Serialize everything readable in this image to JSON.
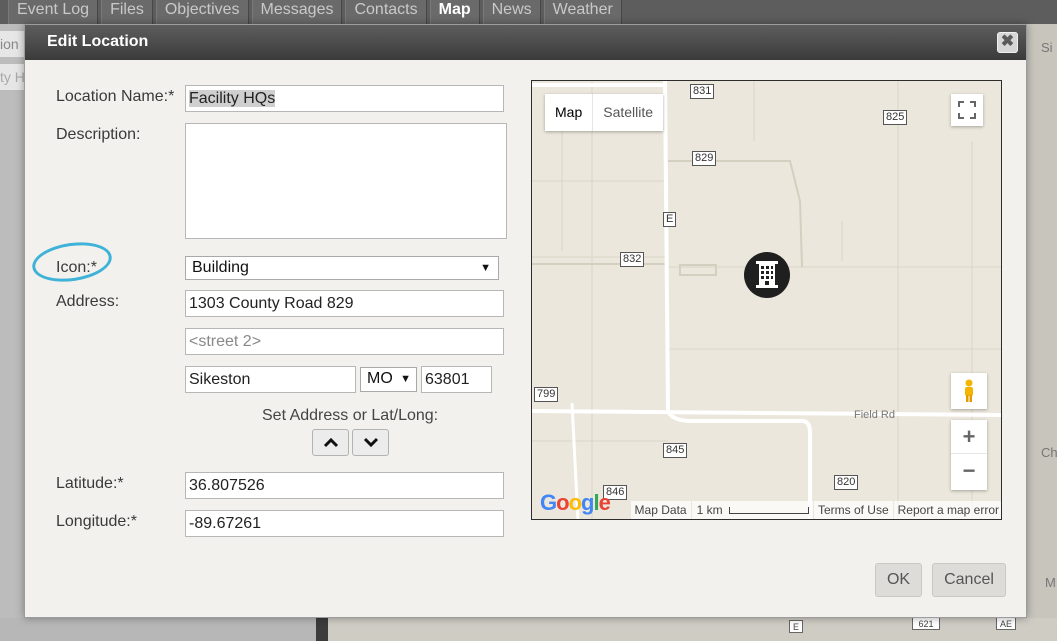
{
  "bg": {
    "tabs": [
      "Event Log",
      "Files",
      "Objectives",
      "Messages",
      "Contacts",
      "Map",
      "News",
      "Weather"
    ],
    "active_tab": "Map",
    "left_frag_1": "ion",
    "left_frag_2": "ty H",
    "right_frag_1": "Si",
    "right_frag_2": "Ch",
    "right_frag_3": "M",
    "shield_621": "621",
    "shield_ae": "AE",
    "shield_e": "E"
  },
  "dialog": {
    "title": "Edit Location",
    "close_glyph": "✖",
    "labels": {
      "location_name": "Location Name:*",
      "description": "Description:",
      "icon": "Icon:*",
      "address": "Address:",
      "latitude": "Latitude:*",
      "longitude": "Longitude:*"
    },
    "location_name": "Facility HQs",
    "description": "",
    "icon_value": "Building",
    "address_1": "1303 County Road 829",
    "address_2_placeholder": "<street 2>",
    "city": "Sikeston",
    "state": "MO",
    "zip": "63801",
    "set_address_label": "Set Address or Lat/Long:",
    "latitude": "36.807526",
    "longitude": "-89.67261",
    "ok_label": "OK",
    "cancel_label": "Cancel"
  },
  "map": {
    "type_map": "Map",
    "type_satellite": "Satellite",
    "shields": {
      "s831": "831",
      "s825": "825",
      "s829": "829",
      "sE": "E",
      "s832": "832",
      "s799": "799",
      "s845": "845",
      "s820": "820",
      "s846": "846"
    },
    "road_field": "Field Rd",
    "zoom_in": "+",
    "zoom_out": "−",
    "google": "Google",
    "footer": {
      "map_data": "Map Data",
      "scale": "1 km",
      "terms": "Terms of Use",
      "report": "Report a map error"
    }
  }
}
